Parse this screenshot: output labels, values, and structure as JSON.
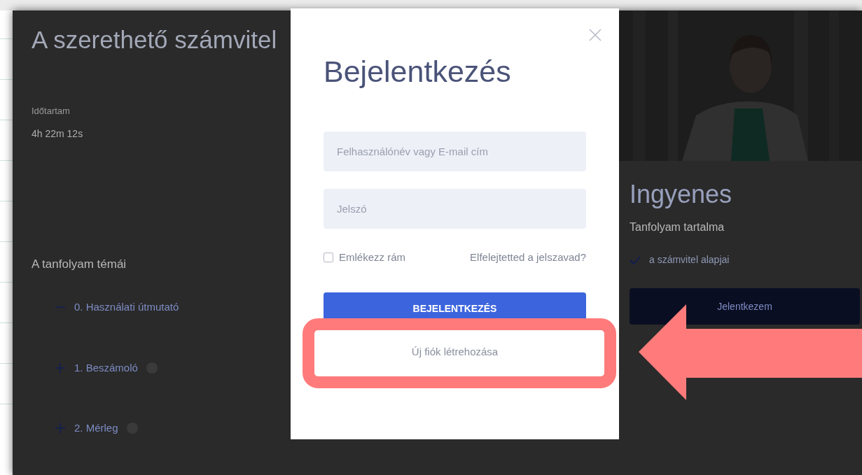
{
  "page": {
    "title": "A szerethető számvitel",
    "duration_label": "Időtartam",
    "duration": "4h 22m 12s",
    "topics_heading": "A tanfolyam témái",
    "topics": [
      {
        "label": "0. Használati útmutató",
        "expanded": true,
        "info": false
      },
      {
        "label": "1. Beszámoló",
        "expanded": false,
        "info": true
      },
      {
        "label": "2. Mérleg",
        "expanded": false,
        "info": true
      }
    ]
  },
  "course_card": {
    "price": "Ingyenes",
    "contents_heading": "Tanfolyam tartalma",
    "contents": [
      "a számvitel alapjai"
    ],
    "enroll_button": "Jelentkezem"
  },
  "login_dialog": {
    "title": "Bejelentkezés",
    "fields": [
      {
        "placeholder": "Felhasználónév vagy E-mail cím"
      },
      {
        "placeholder": "Jelszó"
      }
    ],
    "remember": {
      "label": "Emlékezz rám",
      "checked": false
    },
    "forgot_link": "Elfelejtetted a jelszavad?",
    "submit_button": "BEJELENTKEZÉS",
    "register_button": "Új fiók létrehozása"
  }
}
